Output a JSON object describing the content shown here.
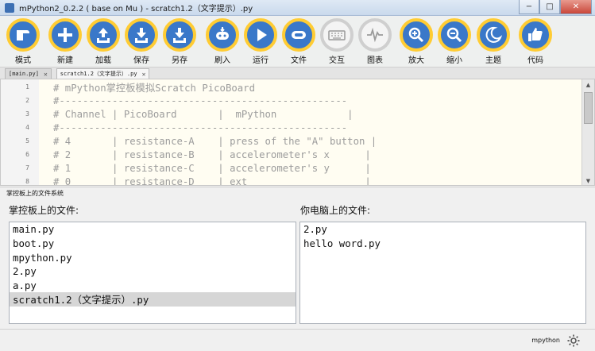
{
  "window": {
    "title": "mPython2_0.2.2 ( base on Mu ) - scratch1.2（文字提示）.py",
    "minimize_glyph": "−",
    "maximize_glyph": "□",
    "close_glyph": "✕"
  },
  "toolbar": {
    "buttons": [
      {
        "label": "模式",
        "icon": "mode-icon"
      },
      {
        "label": "新建",
        "icon": "plus-icon"
      },
      {
        "label": "加载",
        "icon": "upload-icon"
      },
      {
        "label": "保存",
        "icon": "download-icon"
      },
      {
        "label": "另存",
        "icon": "download-icon"
      },
      {
        "label": "刷入",
        "icon": "flash-icon"
      },
      {
        "label": "运行",
        "icon": "play-icon"
      },
      {
        "label": "文件",
        "icon": "files-icon"
      },
      {
        "label": "交互",
        "icon": "keyboard-icon"
      },
      {
        "label": "图表",
        "icon": "pulse-icon"
      },
      {
        "label": "放大",
        "icon": "zoom-in-icon"
      },
      {
        "label": "缩小",
        "icon": "zoom-out-icon"
      },
      {
        "label": "主题",
        "icon": "moon-icon"
      },
      {
        "label": "代码",
        "icon": "thumbs-up-icon"
      }
    ]
  },
  "tabs": [
    {
      "label": "[main.py]",
      "close": "✕"
    },
    {
      "label": "scratch1.2（文字提示）.py",
      "close": "✕"
    }
  ],
  "editor": {
    "lines": [
      {
        "num": "1",
        "text": "# mPython掌控板模拟Scratch PicoBoard"
      },
      {
        "num": "2",
        "text": "#-------------------------------------------------"
      },
      {
        "num": "3",
        "text": "# Channel | PicoBoard       |  mPython            |"
      },
      {
        "num": "4",
        "text": "#-------------------------------------------------"
      },
      {
        "num": "5",
        "text": "# 4       | resistance-A    | press of the \"A\" button |"
      },
      {
        "num": "6",
        "text": "# 2       | resistance-B    | accelerometer's x      |"
      },
      {
        "num": "7",
        "text": "# 1       | resistance-C    | accelerometer's y      |"
      },
      {
        "num": "8",
        "text": "# 0       | resistance-D    | ext                    |"
      }
    ]
  },
  "filesystem": {
    "title": "掌控板上的文件系统",
    "left_label": "掌控板上的文件:",
    "right_label": "你电脑上的文件:",
    "device_files": [
      "main.py",
      "boot.py",
      "mpython.py",
      "2.py",
      "a.py",
      "scratch1.2（文字提示）.py"
    ],
    "computer_files": [
      "2.py",
      "hello word.py"
    ]
  },
  "status": {
    "mode": "mpython"
  }
}
